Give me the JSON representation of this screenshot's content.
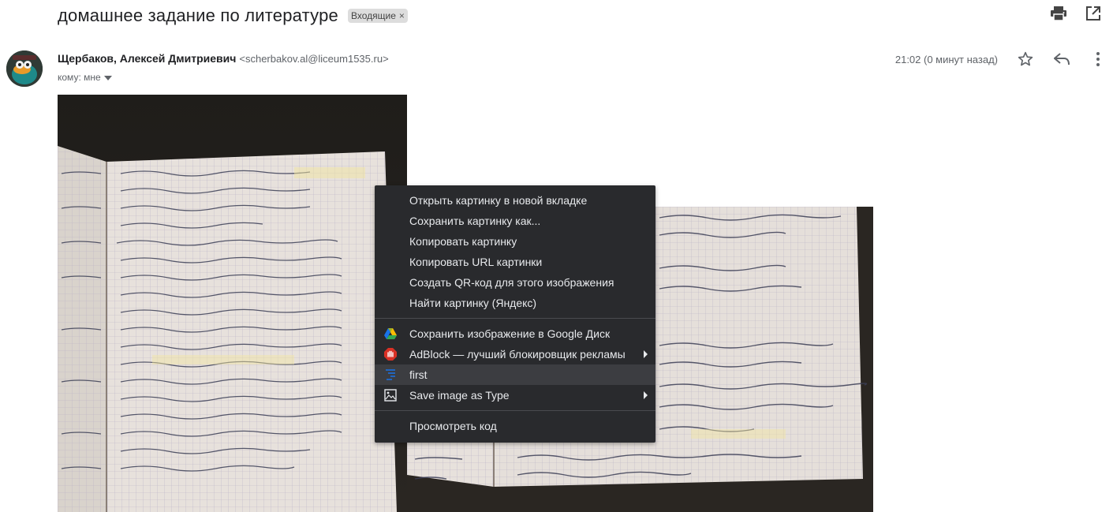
{
  "email": {
    "subject": "домашнее задание по литературе",
    "label": "Входящие",
    "sender_name": "Щербаков, Алексей Дмитриевич",
    "sender_email": "<scherbakov.al@liceum1535.ru>",
    "to_text": "кому: мне",
    "time": "21:02 (0 минут назад)"
  },
  "icons": {
    "print": "print-icon",
    "open_new": "open-in-new-window-icon",
    "star": "star-icon",
    "reply": "reply-icon",
    "more": "more-vert-icon"
  },
  "context_menu": {
    "group1": [
      "Открыть картинку в новой вкладке",
      "Сохранить картинку как...",
      "Копировать картинку",
      "Копировать URL картинки",
      "Создать QR-код для этого изображения",
      "Найти картинку (Яндекс)"
    ],
    "group2": [
      {
        "label": "Сохранить изображение в Google Диск",
        "icon": "google-drive-icon",
        "submenu": false
      },
      {
        "label": "AdBlock — лучший блокировщик рекламы",
        "icon": "adblock-icon",
        "submenu": true
      },
      {
        "label": "first",
        "icon": "extension-first-icon",
        "submenu": false,
        "highlighted": true
      },
      {
        "label": "Save image as Type",
        "icon": "image-icon",
        "submenu": true
      }
    ],
    "group3": [
      "Просмотреть код"
    ]
  },
  "colors": {
    "menu_bg": "#292a2d",
    "menu_text": "#e8eaed",
    "menu_highlight": "#3c3d41",
    "adblock_red": "#d93025"
  }
}
